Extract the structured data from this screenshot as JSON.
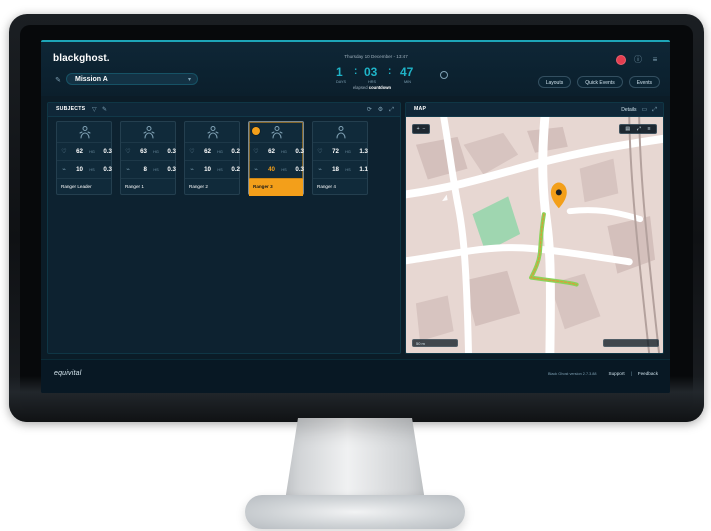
{
  "header": {
    "logo_text": "blackghost.",
    "date_text": "Thursday 10 December - 13:47",
    "countdown": {
      "days": "1",
      "hours": "03",
      "mins": "47",
      "labels": {
        "days": "DAYS",
        "hours": "HRS",
        "mins": "MIN"
      }
    },
    "elapsed_prefix": "elapsed",
    "elapsed_mode": "countdown",
    "mission_name": "Mission A",
    "buttons": {
      "layouts": "Layouts",
      "quick_events": "Quick Events",
      "events": "Events"
    }
  },
  "subjects": {
    "title": "SUBJECTS",
    "cards": [
      {
        "name": "Ranger Leader",
        "hr": "62",
        "hr_label": "HG",
        "hr_extra": "0.3",
        "bt": "10",
        "bt_label": "HS",
        "bt_extra": "0.3"
      },
      {
        "name": "Ranger 1",
        "hr": "63",
        "hr_label": "HG",
        "hr_extra": "0.3",
        "bt": "8",
        "bt_label": "HS",
        "bt_extra": "0.3"
      },
      {
        "name": "Ranger 2",
        "hr": "62",
        "hr_label": "HG",
        "hr_extra": "0.2",
        "bt": "10",
        "bt_label": "HS",
        "bt_extra": "0.2"
      },
      {
        "name": "Ranger 3",
        "hr": "62",
        "hr_label": "HG",
        "hr_extra": "0.3",
        "bt": "40",
        "bt_label": "HS",
        "bt_extra": "0.3",
        "selected": true
      },
      {
        "name": "Ranger 4",
        "hr": "72",
        "hr_label": "HG",
        "hr_extra": "1.3",
        "bt": "18",
        "bt_label": "HS",
        "bt_extra": "1.1"
      }
    ]
  },
  "map": {
    "title": "MAP",
    "details": "Details",
    "scale": "50 m"
  },
  "footer": {
    "brand": "equivital",
    "small_text": "Black Ghost version 2.7.3.88",
    "support": "Support",
    "feedback": "Feedback"
  },
  "colors": {
    "accent": "#1fb4c8",
    "selected": "#f39f1a",
    "alert": "#e43d4f"
  }
}
